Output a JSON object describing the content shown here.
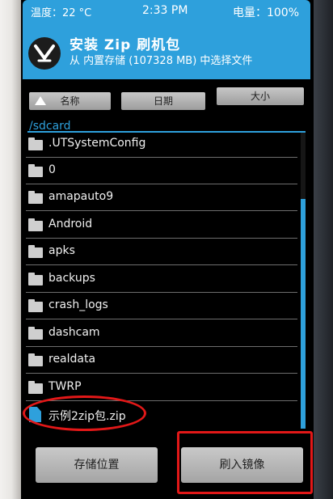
{
  "status": {
    "temperature": "温度：22 °C",
    "time": "2:33 PM",
    "battery": "电量：100%"
  },
  "header": {
    "title": "安装 Zip 刷机包",
    "subtitle": "从 内置存储 (107328 MB) 中选择文件"
  },
  "sort": {
    "name_label": "名称",
    "date_label": "日期",
    "size_label": "大小"
  },
  "path": "/sdcard",
  "files": [
    {
      "name": ".UTSystemConfig",
      "type": "folder"
    },
    {
      "name": "0",
      "type": "folder"
    },
    {
      "name": "amapauto9",
      "type": "folder"
    },
    {
      "name": "Android",
      "type": "folder"
    },
    {
      "name": "apks",
      "type": "folder"
    },
    {
      "name": "backups",
      "type": "folder"
    },
    {
      "name": "crash_logs",
      "type": "folder"
    },
    {
      "name": "dashcam",
      "type": "folder"
    },
    {
      "name": "realdata",
      "type": "folder"
    },
    {
      "name": "TWRP",
      "type": "folder"
    },
    {
      "name": "示例2zip包.zip",
      "type": "file"
    }
  ],
  "buttons": {
    "storage_label": "存储位置",
    "flash_label": "刷入镜像"
  },
  "colors": {
    "accent": "#2ea0dc",
    "annotation": "#e21818"
  }
}
